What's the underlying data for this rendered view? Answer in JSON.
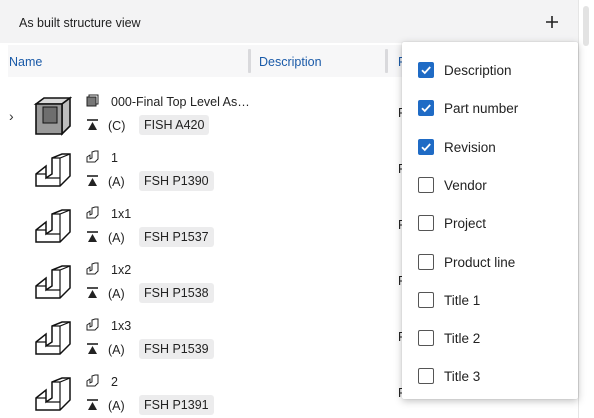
{
  "header": {
    "title": "As built structure view",
    "add_label": "+"
  },
  "columns": {
    "name": "Name",
    "description": "Description",
    "partial": "P"
  },
  "rows": [
    {
      "name": "000-Final Top Level As…",
      "rev": "(C)",
      "part": "FISH A420",
      "p": "F",
      "expandable": true,
      "assembly": true
    },
    {
      "name": "1",
      "rev": "(A)",
      "part": "FSH P1390",
      "p": "F",
      "expandable": false,
      "assembly": false
    },
    {
      "name": "1x1",
      "rev": "(A)",
      "part": "FSH P1537",
      "p": "F",
      "expandable": false,
      "assembly": false
    },
    {
      "name": "1x2",
      "rev": "(A)",
      "part": "FSH P1538",
      "p": "F",
      "expandable": false,
      "assembly": false
    },
    {
      "name": "1x3",
      "rev": "(A)",
      "part": "FSH P1539",
      "p": "F",
      "expandable": false,
      "assembly": false
    },
    {
      "name": "2",
      "rev": "(A)",
      "part": "FSH P1391",
      "p": "F",
      "expandable": false,
      "assembly": false
    }
  ],
  "column_menu": {
    "options": [
      {
        "label": "Description",
        "checked": true
      },
      {
        "label": "Part number",
        "checked": true
      },
      {
        "label": "Revision",
        "checked": true
      },
      {
        "label": "Vendor",
        "checked": false
      },
      {
        "label": "Project",
        "checked": false
      },
      {
        "label": "Product line",
        "checked": false
      },
      {
        "label": "Title 1",
        "checked": false
      },
      {
        "label": "Title 2",
        "checked": false
      },
      {
        "label": "Title 3",
        "checked": false
      }
    ]
  },
  "icons": {
    "chevron": "chevron-right-icon",
    "assembly": "assembly-cube-icon",
    "part": "part-l-bracket-icon",
    "revision": "revision-marker-icon",
    "add": "plus-icon"
  },
  "colors": {
    "accent": "#1f6bc5",
    "header_text": "#1a5aa8",
    "chip_bg": "#ececed"
  }
}
